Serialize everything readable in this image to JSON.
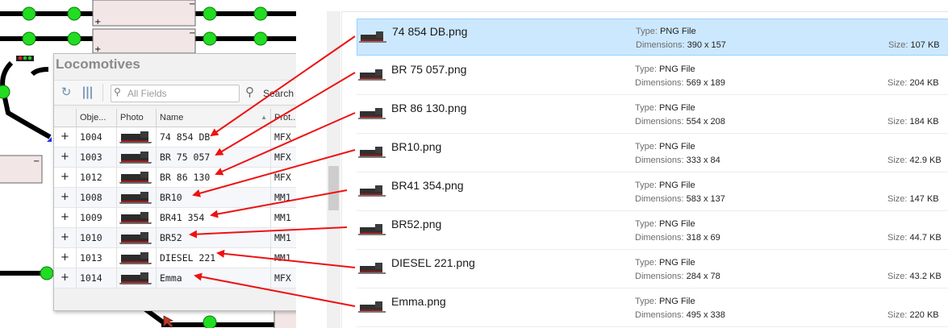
{
  "locomotives_panel": {
    "title": "Locomotives",
    "search_placeholder": "All Fields",
    "search_button": "Search",
    "columns": [
      "Obje...",
      "Photo",
      "Name",
      "Prot..."
    ],
    "rows": [
      {
        "expand": "+",
        "id": "1004",
        "name": "74 854 DB",
        "protocol": "MFX"
      },
      {
        "expand": "+",
        "id": "1003",
        "name": "BR 75 057",
        "protocol": "MFX"
      },
      {
        "expand": "+",
        "id": "1012",
        "name": "BR 86 130",
        "protocol": "MFX"
      },
      {
        "expand": "+",
        "id": "1008",
        "name": "BR10",
        "protocol": "MM1"
      },
      {
        "expand": "+",
        "id": "1009",
        "name": "BR41 354",
        "protocol": "MM1"
      },
      {
        "expand": "+",
        "id": "1010",
        "name": "BR52",
        "protocol": "MM1"
      },
      {
        "expand": "+",
        "id": "1013",
        "name": "DIESEL 221",
        "protocol": "MM1"
      },
      {
        "expand": "+",
        "id": "1014",
        "name": "Emma",
        "protocol": "MFX"
      }
    ]
  },
  "file_list": {
    "type_label": "Type:",
    "dimensions_label": "Dimensions:",
    "size_label": "Size:",
    "files": [
      {
        "name": "74 854 DB.png",
        "type": "PNG File",
        "dimensions": "390 x 157",
        "size": "107 KB",
        "selected": true
      },
      {
        "name": "BR 75 057.png",
        "type": "PNG File",
        "dimensions": "569 x 189",
        "size": "204 KB"
      },
      {
        "name": "BR 86 130.png",
        "type": "PNG File",
        "dimensions": "554 x 208",
        "size": "184 KB"
      },
      {
        "name": "BR10.png",
        "type": "PNG File",
        "dimensions": "333 x 84",
        "size": "42.9 KB"
      },
      {
        "name": "BR41 354.png",
        "type": "PNG File",
        "dimensions": "583 x 137",
        "size": "147 KB"
      },
      {
        "name": "BR52.png",
        "type": "PNG File",
        "dimensions": "318 x 69",
        "size": "44.7 KB"
      },
      {
        "name": "DIESEL 221.png",
        "type": "PNG File",
        "dimensions": "284 x 78",
        "size": "43.2 KB"
      },
      {
        "name": "Emma.png",
        "type": "PNG File",
        "dimensions": "495 x 338",
        "size": "220 KB"
      }
    ]
  },
  "colors": {
    "track": "#000000",
    "signal_green": "#22dd22",
    "block_fill": "#f3e6e6",
    "arrow_red": "#ee1111",
    "selection": "#cce8ff"
  }
}
